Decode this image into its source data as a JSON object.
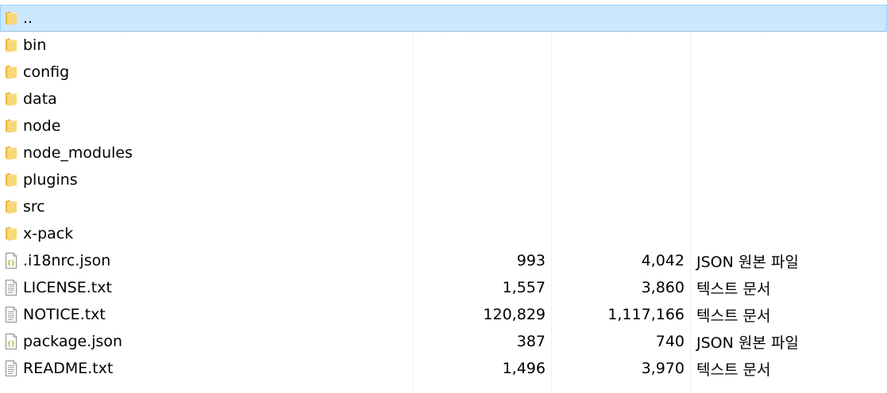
{
  "files": [
    {
      "icon": "folder-icon",
      "name": "..",
      "size": "",
      "packed": "",
      "type": "",
      "selected": true
    },
    {
      "icon": "folder-icon",
      "name": "bin",
      "size": "",
      "packed": "",
      "type": ""
    },
    {
      "icon": "folder-icon",
      "name": "config",
      "size": "",
      "packed": "",
      "type": ""
    },
    {
      "icon": "folder-icon",
      "name": "data",
      "size": "",
      "packed": "",
      "type": ""
    },
    {
      "icon": "folder-icon",
      "name": "node",
      "size": "",
      "packed": "",
      "type": ""
    },
    {
      "icon": "folder-icon",
      "name": "node_modules",
      "size": "",
      "packed": "",
      "type": ""
    },
    {
      "icon": "folder-icon",
      "name": "plugins",
      "size": "",
      "packed": "",
      "type": ""
    },
    {
      "icon": "folder-icon",
      "name": "src",
      "size": "",
      "packed": "",
      "type": ""
    },
    {
      "icon": "folder-icon",
      "name": "x-pack",
      "size": "",
      "packed": "",
      "type": ""
    },
    {
      "icon": "json-file-icon",
      "name": ".i18nrc.json",
      "size": "993",
      "packed": "4,042",
      "type": "JSON 원본 파일"
    },
    {
      "icon": "text-file-icon",
      "name": "LICENSE.txt",
      "size": "1,557",
      "packed": "3,860",
      "type": "텍스트 문서"
    },
    {
      "icon": "text-file-icon",
      "name": "NOTICE.txt",
      "size": "120,829",
      "packed": "1,117,166",
      "type": "텍스트 문서"
    },
    {
      "icon": "json-file-icon",
      "name": "package.json",
      "size": "387",
      "packed": "740",
      "type": "JSON 원본 파일"
    },
    {
      "icon": "text-file-icon",
      "name": "README.txt",
      "size": "1,496",
      "packed": "3,970",
      "type": "텍스트 문서"
    }
  ],
  "colors": {
    "selection_bg": "#cce8ff",
    "selection_border": "#99d1ff",
    "folder_yellow": "#f8d775",
    "json_brace": "#a8b400"
  }
}
